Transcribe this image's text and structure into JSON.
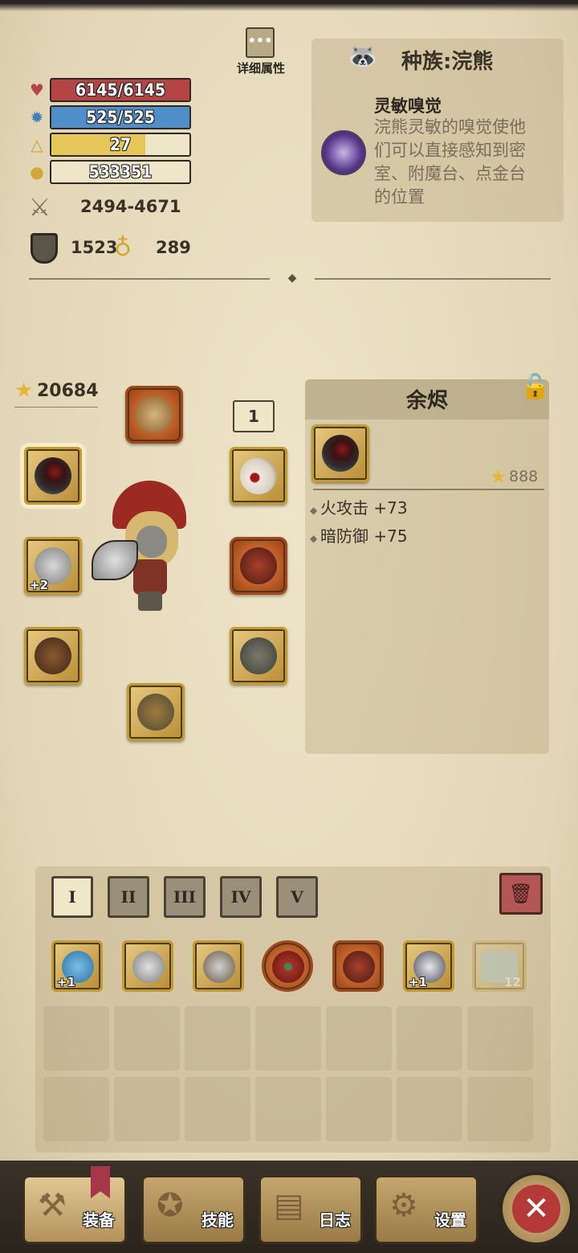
{
  "header": {
    "detail_label": "详细属性"
  },
  "race": {
    "title": "种族:浣熊",
    "skill_title": "灵敏嗅觉",
    "skill_desc_lines": [
      "浣熊灵敏的嗅觉使他",
      "们可以直接感知到密",
      "室、附魔台、点金台",
      "的位置"
    ]
  },
  "stats": {
    "hp": {
      "text": "6145/6145",
      "fraction": 1.0,
      "color": "#b54444"
    },
    "mp": {
      "text": "525/525",
      "fraction": 1.0,
      "color": "#4f8ec9"
    },
    "level": {
      "text": "27",
      "fraction": 0.68,
      "color": "#e6c85a"
    },
    "gold": {
      "text": "533351",
      "fraction": 0.0,
      "color": "#efe5c9"
    },
    "attack": "2494-4671",
    "armor": "1523",
    "magic": "289"
  },
  "equipment": {
    "score": "20684",
    "count_badge": "1",
    "slots": [
      {
        "name": "helmet-slot",
        "icon": "spartan-helmet-icon",
        "style": "orange"
      },
      {
        "name": "ring-slot",
        "icon": "ruby-ring-icon",
        "style": "gold",
        "selected": true
      },
      {
        "name": "amulet-slot",
        "icon": "eyeball-amulet-icon",
        "style": "gold"
      },
      {
        "name": "weapon-slot",
        "icon": "battle-axe-icon",
        "style": "gold",
        "plus": "+2"
      },
      {
        "name": "armor-slot",
        "icon": "red-armor-icon",
        "style": "orange"
      },
      {
        "name": "gloves-slot",
        "icon": "gloves-icon",
        "style": "gold"
      },
      {
        "name": "pants-slot",
        "icon": "pants-icon",
        "style": "gold"
      },
      {
        "name": "boots-slot",
        "icon": "boots-icon",
        "style": "gold"
      }
    ]
  },
  "detail": {
    "item_name": "余烬",
    "item_score": "888",
    "attributes": [
      "火攻击 +73",
      "暗防御 +75"
    ]
  },
  "inventory": {
    "tabs": [
      "I",
      "II",
      "III",
      "IV",
      "V"
    ],
    "active_tab": 0,
    "items": [
      {
        "icon": "blue-dagger-icon",
        "plus": "+1",
        "style": "gold"
      },
      {
        "icon": "double-axe-icon",
        "style": "gold"
      },
      {
        "icon": "short-sword-icon",
        "style": "gold"
      },
      {
        "icon": "red-scarf-icon",
        "style": "orange"
      },
      {
        "icon": "red-cape-icon",
        "style": "orange"
      },
      {
        "icon": "spiked-ring-icon",
        "plus": "+1",
        "style": "gold"
      },
      {
        "icon": "scroll-icon",
        "count": "12",
        "style": "faded"
      }
    ]
  },
  "nav": {
    "equip": "装备",
    "skill": "技能",
    "log": "日志",
    "settings": "设置"
  }
}
